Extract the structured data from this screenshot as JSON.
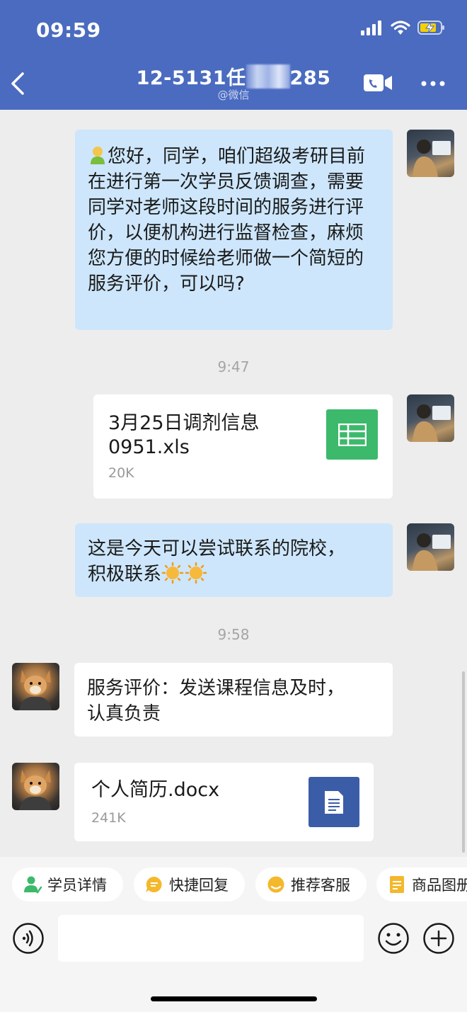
{
  "status_bar": {
    "time": "09:59"
  },
  "header": {
    "title_prefix": "12-5131任",
    "title_suffix": "285",
    "subtitle": "@微信"
  },
  "messages": {
    "m1": "您好，同学，咱们超级考研目前在进行第一次学员反馈调查，需要同学对老师这段时间的服务进行评价，以便机构进行监督检查，麻烦您方便的时候给老师做一个简短的服务评价，可以吗?",
    "time1": "9:47",
    "file1": {
      "name_line1": "3月25日调剂信息",
      "name_line2": "0951.xls",
      "size": "20K"
    },
    "m3_line1": "这是今天可以尝试联系的院校，",
    "m3_line2": "积极联系",
    "time2": "9:58",
    "m4_line1": "服务评价：发送课程信息及时，",
    "m4_line2": "认真负责",
    "file2": {
      "name": "个人简历.docx",
      "size": "241K"
    }
  },
  "quick_bar": {
    "chips": [
      {
        "label": "学员详情"
      },
      {
        "label": "快捷回复"
      },
      {
        "label": "推荐客服"
      },
      {
        "label": "商品图册"
      }
    ]
  },
  "colors": {
    "header_bg": "#4a6bbf",
    "bubble_out": "#cde6fb",
    "xls_green": "#3cb96b",
    "docx_blue": "#3b5da8"
  }
}
